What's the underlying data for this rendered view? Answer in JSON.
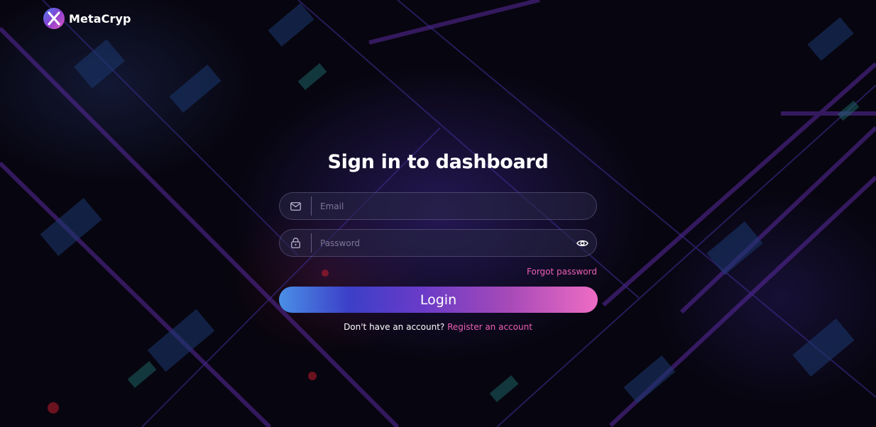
{
  "brand": {
    "name": "MetaCryp"
  },
  "login": {
    "title": "Sign in to dashboard",
    "email": {
      "placeholder": "Email",
      "value": ""
    },
    "password": {
      "placeholder": "Password",
      "value": ""
    },
    "forgot_label": "Forgot password",
    "submit_label": "Login",
    "no_account_text": "Don't have an account?",
    "register_label": "Register an account"
  },
  "icons": {
    "email_field": "envelope-icon",
    "password_field": "lock-icon",
    "password_toggle": "eye-icon"
  },
  "colors": {
    "accent_link": "#ec5fb4",
    "button_gradient_start": "#4a8fe6",
    "button_gradient_end": "#ee6cc4",
    "background": "#07050f"
  }
}
